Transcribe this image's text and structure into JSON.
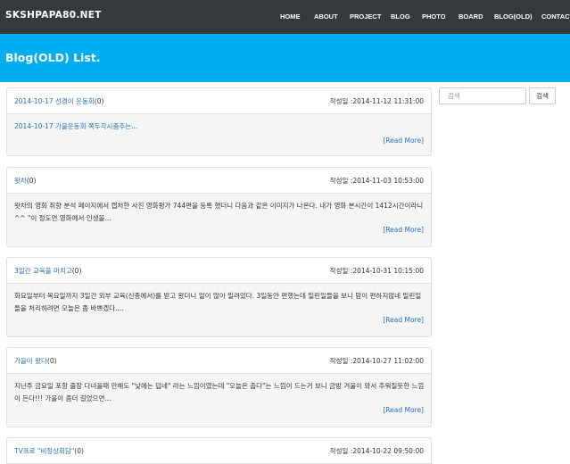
{
  "navbar": {
    "brand": "SKSHPAPA80.NET",
    "items": [
      {
        "label": "HOME"
      },
      {
        "label": "ABOUT"
      },
      {
        "label": "PROJECT"
      },
      {
        "label": "BLOG"
      },
      {
        "label": "PHOTO"
      },
      {
        "label": "BOARD"
      },
      {
        "label": "BLOG(OLD)"
      },
      {
        "label": "CONTACT"
      }
    ]
  },
  "page": {
    "title": "Blog(OLD) List."
  },
  "search": {
    "placeholder": "검색",
    "button_label": "검색"
  },
  "posts": [
    {
      "title": "2014-10-17 선경이 운동회",
      "count": "(0)",
      "date": "작성일 :2014-11-12 11:31:00",
      "excerpt": "2014-10-17 가을운동회 쪽두각시춤추는...",
      "read_more": "[Read More]"
    },
    {
      "title": "왓차",
      "count": "(0)",
      "date": "작성일 :2014-11-03 10:53:00",
      "excerpt": "왓차의 영화 취향 분석 페이지에서 캡처한 사진 영화평가 744편을 등록 했더니 다음과 같은 이미지가 나온다. 내가 영화 본시간이 1412시간이라니^^ \"이 정도면 영화에서 인생을...",
      "read_more": "[Read More]"
    },
    {
      "title": "3일간 교육을 마치고",
      "count": "(0)",
      "date": "작성일 :2014-10-31 10:15:00",
      "excerpt": "화요일부터 목요일까지 3일간 외부 교육(신종에서)를 받고 왔더니 일이 많이 밀려있다. 3일동안 편했는데 밀린일들을 보니 맘이 편하지않네 밀린일들을 처리하려면 오늘은 좀 바쁘겠다....",
      "read_more": "[Read More]"
    },
    {
      "title": "가을이 왔다",
      "count": "(0)",
      "date": "작성일 :2014-10-27 11:02:00",
      "excerpt": "지난주 금요일 포항 출장 다녀올때 만해도 \"낮에는 덥네\" 라는 느낌이였는데 \"오늘은 춥다\"는 느낌이 드는거 보니 금방 겨울이 와서 추워질듯한 느낌이 든다!!! 가을이 좀더 길었으면...",
      "read_more": "[Read More]"
    },
    {
      "title": "TV프로 \"비정상회담\"",
      "count": "(0)",
      "date": "작성일 :2014-10-22 09:50:00"
    }
  ]
}
